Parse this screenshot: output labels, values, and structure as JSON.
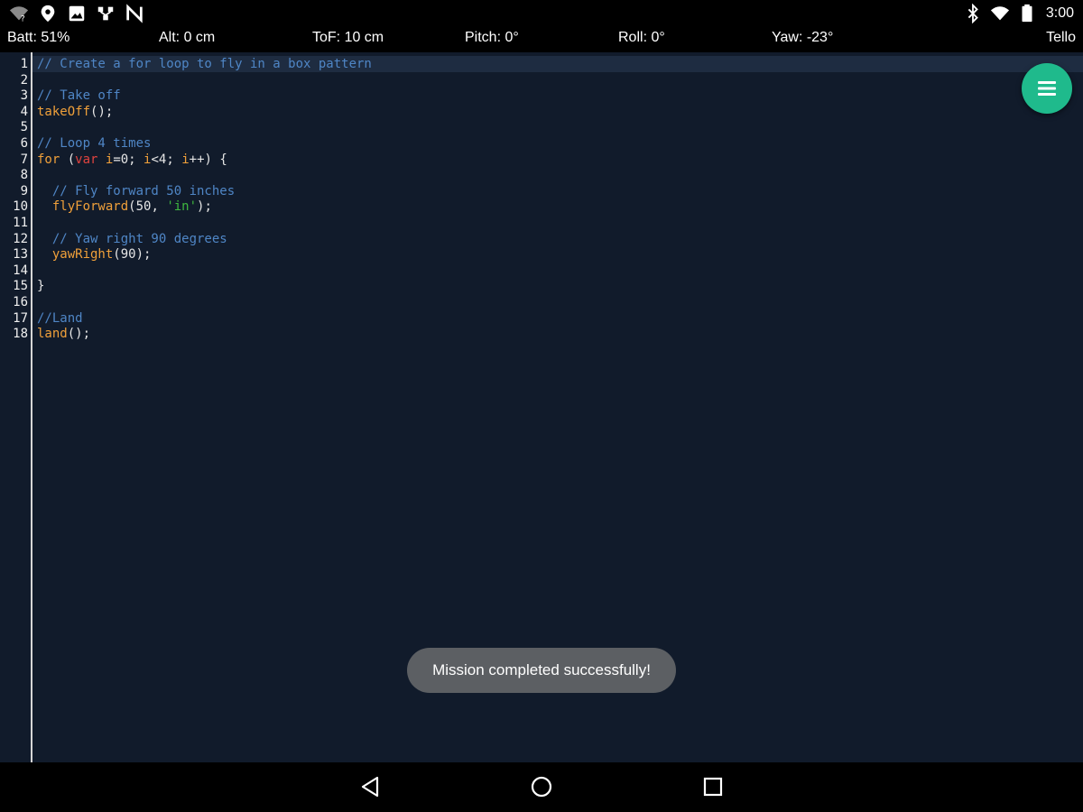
{
  "status_bar": {
    "left_icons": [
      "wifi-question-icon",
      "location-pin-icon",
      "image-icon",
      "network-icon",
      "nfc-icon"
    ],
    "right_icons": [
      "bluetooth-icon",
      "wifi-icon",
      "battery-icon"
    ],
    "clock": "3:00"
  },
  "telemetry": {
    "battery": "Batt: 51%",
    "altitude": "Alt: 0 cm",
    "time_of_flight": "ToF: 10 cm",
    "pitch": "Pitch: 0°",
    "roll": "Roll: 0°",
    "yaw": "Yaw: -23°",
    "device": "Tello"
  },
  "editor": {
    "active_line": 1,
    "lines": [
      {
        "n": "1",
        "text": "// Create a for loop to fly in a box pattern"
      },
      {
        "n": "2",
        "text": ""
      },
      {
        "n": "3",
        "text": "// Take off"
      },
      {
        "n": "4",
        "text": "takeOff();"
      },
      {
        "n": "5",
        "text": ""
      },
      {
        "n": "6",
        "text": "// Loop 4 times"
      },
      {
        "n": "7",
        "text": "for (var i=0; i<4; i++) {"
      },
      {
        "n": "8",
        "text": ""
      },
      {
        "n": "9",
        "text": "  // Fly forward 50 inches"
      },
      {
        "n": "10",
        "text": "  flyForward(50, 'in');"
      },
      {
        "n": "11",
        "text": ""
      },
      {
        "n": "12",
        "text": "  // Yaw right 90 degrees"
      },
      {
        "n": "13",
        "text": "  yawRight(90);"
      },
      {
        "n": "14",
        "text": ""
      },
      {
        "n": "15",
        "text": "}"
      },
      {
        "n": "16",
        "text": ""
      },
      {
        "n": "17",
        "text": "//Land"
      },
      {
        "n": "18",
        "text": "land();"
      }
    ]
  },
  "fab": {
    "icon": "menu-icon",
    "color": "#1fba8c"
  },
  "toast": {
    "message": "Mission completed successfully!"
  },
  "nav_bar": {
    "icons": [
      "back-icon",
      "home-icon",
      "recents-icon"
    ]
  },
  "colors": {
    "background": "#111b2b",
    "comment": "#4f86c6",
    "function": "#f0a03a",
    "keyword": "#e0433f",
    "string": "#3fb83f"
  }
}
